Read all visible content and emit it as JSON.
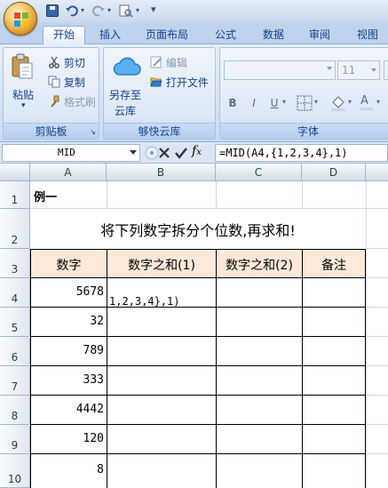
{
  "quick_access": {
    "more": "▾"
  },
  "tabs": [
    {
      "label": "开始",
      "active": true
    },
    {
      "label": "插入",
      "active": false
    },
    {
      "label": "页面布局",
      "active": false
    },
    {
      "label": "公式",
      "active": false
    },
    {
      "label": "数据",
      "active": false
    },
    {
      "label": "审阅",
      "active": false
    },
    {
      "label": "视图",
      "active": false
    }
  ],
  "ribbon": {
    "clipboard": {
      "paste": "粘贴",
      "cut": "剪切",
      "copy": "复制",
      "format_painter": "格式刷",
      "label": "剪贴板"
    },
    "cloud": {
      "save_to_cloud": "另存至",
      "save_to_cloud_2": "云库",
      "edit": "编辑",
      "open_file": "打开文件",
      "label": "够快云库"
    },
    "font": {
      "font_size": "11",
      "bold": "B",
      "italic": "I",
      "underline": "U",
      "font_color": "A",
      "label": "字体"
    }
  },
  "formula_bar": {
    "name_box": "MID",
    "formula": "=MID(A4,{1,2,3,4},1)"
  },
  "columns": [
    "A",
    "B",
    "C",
    "D"
  ],
  "rows": [
    "1",
    "2",
    "3",
    "4",
    "5",
    "6",
    "7",
    "8",
    "9",
    "10"
  ],
  "sheet": {
    "a1": "例一",
    "title": "将下列数字拆分个位数,再求和!",
    "headers": [
      "数字",
      "数字之和(1)",
      "数字之和(2)",
      "备注"
    ],
    "numbers": [
      "5678",
      "32",
      "789",
      "333",
      "4442",
      "120",
      "8"
    ],
    "b4_edit": "1,2,3,4},1)"
  },
  "colors": {
    "header_fill": "#fde9d9",
    "ribbon_bg": "#dbe6f6",
    "text_blue": "#15428b"
  }
}
